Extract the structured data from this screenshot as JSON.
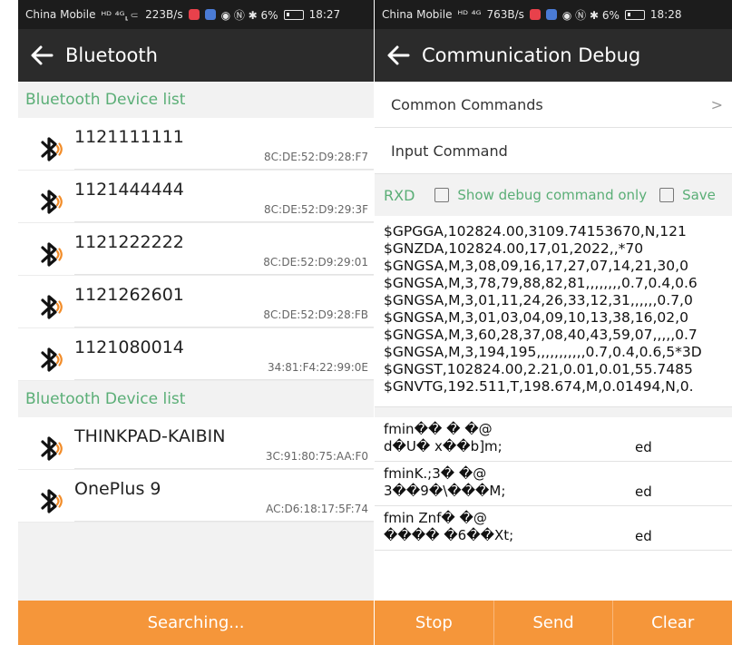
{
  "left": {
    "status": {
      "carrier": "China Mobile",
      "signal": "ᴴᴰ ⁴ᴳ⸤⸦",
      "speed": "223B/s",
      "icons": "◉ Ⓝ ✱ 6%",
      "time": "18:27"
    },
    "title": "Bluetooth",
    "paired_header": "Bluetooth Device list",
    "paired": [
      {
        "name": "1121111111",
        "mac": "8C:DE:52:D9:28:F7"
      },
      {
        "name": "1121444444",
        "mac": "8C:DE:52:D9:29:3F"
      },
      {
        "name": "1121222222",
        "mac": "8C:DE:52:D9:29:01"
      },
      {
        "name": "1121262601",
        "mac": "8C:DE:52:D9:28:FB"
      },
      {
        "name": "1121080014",
        "mac": "34:81:F4:22:99:0E"
      }
    ],
    "found_header": "Bluetooth Device list",
    "found": [
      {
        "name": "THINKPAD-KAIBIN",
        "mac": "3C:91:80:75:AA:F0"
      },
      {
        "name": "OnePlus 9",
        "mac": "AC:D6:18:17:5F:74"
      }
    ],
    "search_button": "Searching..."
  },
  "right": {
    "status": {
      "carrier": "China Mobile",
      "signal": "ᴴᴰ ⁴ᴳ",
      "speed": "763B/s",
      "icons": "◉ Ⓝ ✱ 6%",
      "time": "18:28"
    },
    "title": "Communication Debug",
    "common_commands": "Common Commands",
    "chevron": ">",
    "input_command": "Input Command",
    "rxd_label": "RXD",
    "show_debug_label": "Show debug command only",
    "save_label": "Save",
    "log_lines": [
      "$GPGGA,102824.00,3109.74153670,N,121",
      "$GNZDA,102824.00,17,01,2022,,*70",
      "$GNGSA,M,3,08,09,16,17,27,07,14,21,30,0",
      "$GNGSA,M,3,78,79,88,82,81,,,,,,,,0.7,0.4,0.6",
      "$GNGSA,M,3,01,11,24,26,33,12,31,,,,,,0.7,0",
      "$GNGSA,M,3,01,03,04,09,10,13,38,16,02,0",
      "$GNGSA,M,3,60,28,37,08,40,43,59,07,,,,,0.7",
      "$GNGSA,M,3,194,195,,,,,,,,,,,0.7,0.4,0.6,5*3D",
      "$GNGST,102824.00,2.21,0.01,0.01,55.7485",
      "$GNVTG,192.511,T,198.674,M,0.01494,N,0."
    ],
    "binary_entries": [
      {
        "line1": "fmin��   �     �@",
        "line2": "d�U� x��b]m;",
        "tail": "ed"
      },
      {
        "line1": "fminK.;3�   �@",
        "line2": "3��9�\\���M;",
        "tail": "ed"
      },
      {
        "line1": "fmin Znf�    �@",
        "line2": "���� �6��Xt;",
        "tail": "ed"
      }
    ],
    "buttons": {
      "stop": "Stop",
      "send": "Send",
      "clear": "Clear"
    }
  },
  "colors": {
    "accent_green": "#5aae76",
    "button_orange": "#f5963a",
    "titlebar": "#2b2b2b",
    "statusbar": "#1c1c1c"
  }
}
